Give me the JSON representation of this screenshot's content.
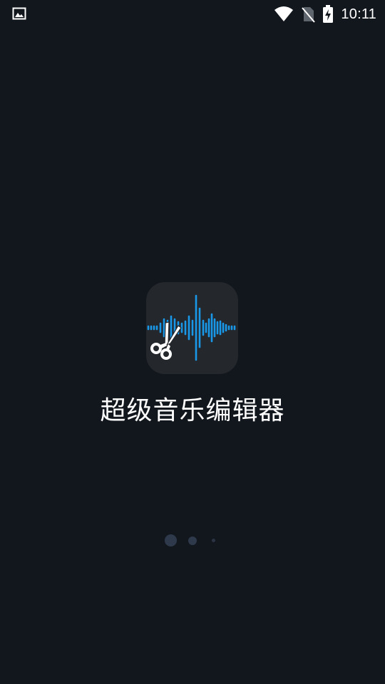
{
  "status_bar": {
    "time": "10:11",
    "icons": [
      "image-notification-icon",
      "wifi-icon",
      "no-sim-icon",
      "battery-charging-icon"
    ]
  },
  "splash": {
    "app_name": "超级音乐编辑器",
    "app_icon": "waveform-scissors-icon",
    "accent_color": "#1a98e8",
    "loading_dots": {
      "count": 3,
      "active_index": 0
    }
  },
  "colors": {
    "background": "#12171e",
    "icon_tile": "#24272c",
    "dot": "#2e3a4c"
  }
}
